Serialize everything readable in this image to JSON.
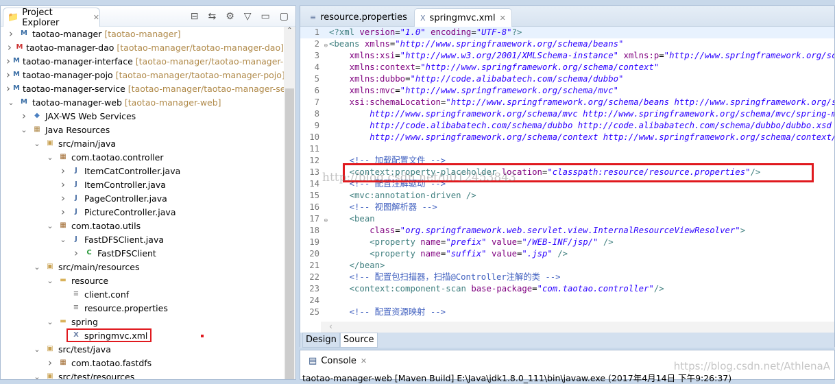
{
  "explorer": {
    "title": "Project Explorer",
    "close": "✕",
    "tools": [
      "⊟",
      "⇆",
      "⚙",
      "▽",
      "▭",
      "▢"
    ],
    "items": [
      {
        "level": 0,
        "chev": "right",
        "icon": "maven-project",
        "label": "taotao-manager",
        "deco": "[taotao-manager]"
      },
      {
        "level": 0,
        "chev": "right",
        "icon": "maven-project-error",
        "label": "taotao-manager-dao",
        "deco": "[taotao-manager/taotao-manager-dao]"
      },
      {
        "level": 0,
        "chev": "right",
        "icon": "maven-project",
        "label": "taotao-manager-interface",
        "deco": "[taotao-manager/taotao-manager-interface]"
      },
      {
        "level": 0,
        "chev": "right",
        "icon": "maven-project",
        "label": "taotao-manager-pojo",
        "deco": "[taotao-manager/taotao-manager-pojo]"
      },
      {
        "level": 0,
        "chev": "right",
        "icon": "maven-project",
        "label": "taotao-manager-service",
        "deco": "[taotao-manager/taotao-manager-service]"
      },
      {
        "level": 0,
        "chev": "down",
        "icon": "maven-project",
        "label": "taotao-manager-web",
        "deco": "[taotao-manager-web]"
      },
      {
        "level": 1,
        "chev": "right",
        "icon": "web-services",
        "label": "JAX-WS Web Services"
      },
      {
        "level": 1,
        "chev": "down",
        "icon": "java-resources",
        "label": "Java Resources"
      },
      {
        "level": 2,
        "chev": "down",
        "icon": "source-folder",
        "label": "src/main/java"
      },
      {
        "level": 3,
        "chev": "down",
        "icon": "package",
        "label": "com.taotao.controller"
      },
      {
        "level": 4,
        "chev": "right",
        "icon": "java-file",
        "label": "ItemCatController.java"
      },
      {
        "level": 4,
        "chev": "right",
        "icon": "java-file",
        "label": "ItemController.java"
      },
      {
        "level": 4,
        "chev": "right",
        "icon": "java-file",
        "label": "PageController.java"
      },
      {
        "level": 4,
        "chev": "right",
        "icon": "java-file",
        "label": "PictureController.java"
      },
      {
        "level": 3,
        "chev": "down",
        "icon": "package",
        "label": "com.taotao.utils"
      },
      {
        "level": 4,
        "chev": "down",
        "icon": "java-file",
        "label": "FastDFSClient.java"
      },
      {
        "level": 5,
        "chev": "right",
        "icon": "class",
        "label": "FastDFSClient"
      },
      {
        "level": 2,
        "chev": "down",
        "icon": "source-folder",
        "label": "src/main/resources"
      },
      {
        "level": 3,
        "chev": "down",
        "icon": "folder",
        "label": "resource"
      },
      {
        "level": 4,
        "chev": "none",
        "icon": "file",
        "label": "client.conf"
      },
      {
        "level": 4,
        "chev": "none",
        "icon": "file",
        "label": "resource.properties"
      },
      {
        "level": 3,
        "chev": "down",
        "icon": "folder",
        "label": "spring"
      },
      {
        "level": 4,
        "chev": "none",
        "icon": "xml-file",
        "label": "springmvc.xml",
        "selected": true
      },
      {
        "level": 2,
        "chev": "down",
        "icon": "source-folder",
        "label": "src/test/java"
      },
      {
        "level": 3,
        "chev": "right",
        "icon": "package",
        "label": "com.taotao.fastdfs"
      },
      {
        "level": 2,
        "chev": "down",
        "icon": "source-folder",
        "label": "src/test/resources"
      }
    ]
  },
  "editor": {
    "tabs": [
      {
        "label": "resource.properties",
        "active": false
      },
      {
        "label": "springmvc.xml",
        "active": true,
        "close": "✕"
      }
    ],
    "lines": [
      [
        [
          "tag",
          "<?xml "
        ],
        [
          "attr",
          "version"
        ],
        [
          "txt",
          "="
        ],
        [
          "val",
          "\"1.0\""
        ],
        [
          "txt",
          " "
        ],
        [
          "attr",
          "encoding"
        ],
        [
          "txt",
          "="
        ],
        [
          "val",
          "\"UTF-8\""
        ],
        [
          "tag",
          "?>"
        ]
      ],
      [
        [
          "tag",
          "<beans "
        ],
        [
          "attr",
          "xmlns"
        ],
        [
          "txt",
          "="
        ],
        [
          "val",
          "\"http://www.springframework.org/schema/beans\""
        ]
      ],
      [
        [
          "txt",
          "    "
        ],
        [
          "attr",
          "xmlns:xsi"
        ],
        [
          "txt",
          "="
        ],
        [
          "val",
          "\"http://www.w3.org/2001/XMLSchema-instance\""
        ],
        [
          "txt",
          " "
        ],
        [
          "attr",
          "xmlns:p"
        ],
        [
          "txt",
          "="
        ],
        [
          "val",
          "\"http://www.springframework.org/schema/p\""
        ]
      ],
      [
        [
          "txt",
          "    "
        ],
        [
          "attr",
          "xmlns:context"
        ],
        [
          "txt",
          "="
        ],
        [
          "val",
          "\"http://www.springframework.org/schema/context\""
        ]
      ],
      [
        [
          "txt",
          "    "
        ],
        [
          "attr",
          "xmlns:dubbo"
        ],
        [
          "txt",
          "="
        ],
        [
          "val",
          "\"http://code.alibabatech.com/schema/dubbo\""
        ]
      ],
      [
        [
          "txt",
          "    "
        ],
        [
          "attr",
          "xmlns:mvc"
        ],
        [
          "txt",
          "="
        ],
        [
          "val",
          "\"http://www.springframework.org/schema/mvc\""
        ]
      ],
      [
        [
          "txt",
          "    "
        ],
        [
          "attr",
          "xsi:schemaLocation"
        ],
        [
          "txt",
          "="
        ],
        [
          "val",
          "\"http://www.springframework.org/schema/beans http://www.springframework.org/schema/beans/spring-beans.xsd"
        ]
      ],
      [
        [
          "val",
          "        http://www.springframework.org/schema/mvc http://www.springframework.org/schema/mvc/spring-mvc.xsd"
        ]
      ],
      [
        [
          "val",
          "        http://code.alibabatech.com/schema/dubbo http://code.alibabatech.com/schema/dubbo/dubbo.xsd"
        ]
      ],
      [
        [
          "val",
          "        http://www.springframework.org/schema/context http://www.springframework.org/schema/context/spring-context.xsd\">"
        ]
      ],
      [],
      [
        [
          "txt",
          "    "
        ],
        [
          "com",
          "<!-- 加载配置文件 -->"
        ]
      ],
      [
        [
          "txt",
          "    "
        ],
        [
          "tag",
          "<context:property-placeholder "
        ],
        [
          "attr",
          "location"
        ],
        [
          "txt",
          "="
        ],
        [
          "val",
          "\"classpath:resource/resource.properties\""
        ],
        [
          "tag",
          "/>"
        ]
      ],
      [
        [
          "txt",
          "    "
        ],
        [
          "com",
          "<!-- 配置注解驱动 -->"
        ]
      ],
      [
        [
          "txt",
          "    "
        ],
        [
          "tag",
          "<mvc:annotation-driven />"
        ]
      ],
      [
        [
          "txt",
          "    "
        ],
        [
          "com",
          "<!-- 视图解析器 -->"
        ]
      ],
      [
        [
          "txt",
          "    "
        ],
        [
          "tag",
          "<bean"
        ]
      ],
      [
        [
          "txt",
          "        "
        ],
        [
          "attr",
          "class"
        ],
        [
          "txt",
          "="
        ],
        [
          "val",
          "\"org.springframework.web.servlet.view.InternalResourceViewResolver\""
        ],
        [
          "tag",
          ">"
        ]
      ],
      [
        [
          "txt",
          "        "
        ],
        [
          "tag",
          "<property "
        ],
        [
          "attr",
          "name"
        ],
        [
          "txt",
          "="
        ],
        [
          "val",
          "\"prefix\""
        ],
        [
          "txt",
          " "
        ],
        [
          "attr",
          "value"
        ],
        [
          "txt",
          "="
        ],
        [
          "val",
          "\"/WEB-INF/jsp/\""
        ],
        [
          "tag",
          " />"
        ]
      ],
      [
        [
          "txt",
          "        "
        ],
        [
          "tag",
          "<property "
        ],
        [
          "attr",
          "name"
        ],
        [
          "txt",
          "="
        ],
        [
          "val",
          "\"suffix\""
        ],
        [
          "txt",
          " "
        ],
        [
          "attr",
          "value"
        ],
        [
          "txt",
          "="
        ],
        [
          "val",
          "\".jsp\""
        ],
        [
          "tag",
          " />"
        ]
      ],
      [
        [
          "txt",
          "    "
        ],
        [
          "tag",
          "</bean>"
        ]
      ],
      [
        [
          "txt",
          "    "
        ],
        [
          "com",
          "<!-- 配置包扫描器，扫描@Controller注解的类 -->"
        ]
      ],
      [
        [
          "txt",
          "    "
        ],
        [
          "tag",
          "<context:component-scan "
        ],
        [
          "attr",
          "base-package"
        ],
        [
          "txt",
          "="
        ],
        [
          "val",
          "\"com.taotao.controller\""
        ],
        [
          "tag",
          "/>"
        ]
      ],
      [],
      [
        [
          "txt",
          "    "
        ],
        [
          "com",
          "<!-- 配置资源映射 -->"
        ]
      ]
    ],
    "fold_lines": [
      2,
      17
    ],
    "watermark": "http://blog.csdn.net/u012453843",
    "bottom_tabs": [
      {
        "label": "Design",
        "active": false
      },
      {
        "label": "Source",
        "active": true
      }
    ]
  },
  "console": {
    "title": "Console",
    "close": "✕",
    "text": "taotao-manager-web [Maven Build] E:\\Java\\jdk1.8.0_111\\bin\\javaw.exe (2017年4月14日 下午9:26:37)",
    "watermark": "https://blog.csdn.net/AthlenaA"
  },
  "colors": {
    "highlight": "#e0191e",
    "tag": "#3f7f7f",
    "attr": "#7f007f",
    "value": "#2a00ff",
    "comment": "#3f5fbf"
  }
}
